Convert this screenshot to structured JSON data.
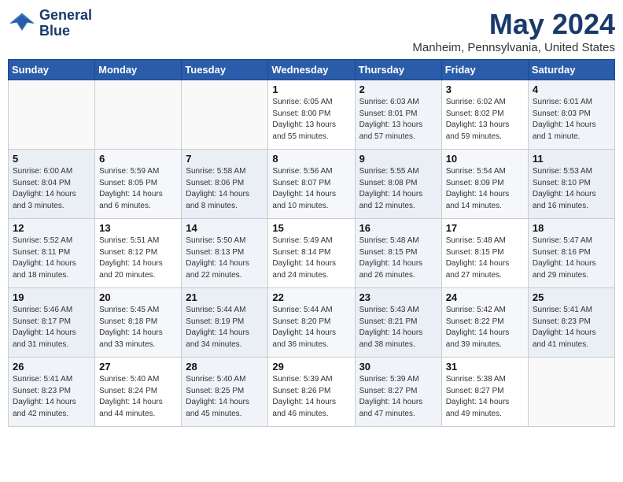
{
  "header": {
    "logo_line1": "General",
    "logo_line2": "Blue",
    "month": "May 2024",
    "location": "Manheim, Pennsylvania, United States"
  },
  "weekdays": [
    "Sunday",
    "Monday",
    "Tuesday",
    "Wednesday",
    "Thursday",
    "Friday",
    "Saturday"
  ],
  "weeks": [
    [
      {
        "day": "",
        "info": ""
      },
      {
        "day": "",
        "info": ""
      },
      {
        "day": "",
        "info": ""
      },
      {
        "day": "1",
        "info": "Sunrise: 6:05 AM\nSunset: 8:00 PM\nDaylight: 13 hours\nand 55 minutes."
      },
      {
        "day": "2",
        "info": "Sunrise: 6:03 AM\nSunset: 8:01 PM\nDaylight: 13 hours\nand 57 minutes."
      },
      {
        "day": "3",
        "info": "Sunrise: 6:02 AM\nSunset: 8:02 PM\nDaylight: 13 hours\nand 59 minutes."
      },
      {
        "day": "4",
        "info": "Sunrise: 6:01 AM\nSunset: 8:03 PM\nDaylight: 14 hours\nand 1 minute."
      }
    ],
    [
      {
        "day": "5",
        "info": "Sunrise: 6:00 AM\nSunset: 8:04 PM\nDaylight: 14 hours\nand 3 minutes."
      },
      {
        "day": "6",
        "info": "Sunrise: 5:59 AM\nSunset: 8:05 PM\nDaylight: 14 hours\nand 6 minutes."
      },
      {
        "day": "7",
        "info": "Sunrise: 5:58 AM\nSunset: 8:06 PM\nDaylight: 14 hours\nand 8 minutes."
      },
      {
        "day": "8",
        "info": "Sunrise: 5:56 AM\nSunset: 8:07 PM\nDaylight: 14 hours\nand 10 minutes."
      },
      {
        "day": "9",
        "info": "Sunrise: 5:55 AM\nSunset: 8:08 PM\nDaylight: 14 hours\nand 12 minutes."
      },
      {
        "day": "10",
        "info": "Sunrise: 5:54 AM\nSunset: 8:09 PM\nDaylight: 14 hours\nand 14 minutes."
      },
      {
        "day": "11",
        "info": "Sunrise: 5:53 AM\nSunset: 8:10 PM\nDaylight: 14 hours\nand 16 minutes."
      }
    ],
    [
      {
        "day": "12",
        "info": "Sunrise: 5:52 AM\nSunset: 8:11 PM\nDaylight: 14 hours\nand 18 minutes."
      },
      {
        "day": "13",
        "info": "Sunrise: 5:51 AM\nSunset: 8:12 PM\nDaylight: 14 hours\nand 20 minutes."
      },
      {
        "day": "14",
        "info": "Sunrise: 5:50 AM\nSunset: 8:13 PM\nDaylight: 14 hours\nand 22 minutes."
      },
      {
        "day": "15",
        "info": "Sunrise: 5:49 AM\nSunset: 8:14 PM\nDaylight: 14 hours\nand 24 minutes."
      },
      {
        "day": "16",
        "info": "Sunrise: 5:48 AM\nSunset: 8:15 PM\nDaylight: 14 hours\nand 26 minutes."
      },
      {
        "day": "17",
        "info": "Sunrise: 5:48 AM\nSunset: 8:15 PM\nDaylight: 14 hours\nand 27 minutes."
      },
      {
        "day": "18",
        "info": "Sunrise: 5:47 AM\nSunset: 8:16 PM\nDaylight: 14 hours\nand 29 minutes."
      }
    ],
    [
      {
        "day": "19",
        "info": "Sunrise: 5:46 AM\nSunset: 8:17 PM\nDaylight: 14 hours\nand 31 minutes."
      },
      {
        "day": "20",
        "info": "Sunrise: 5:45 AM\nSunset: 8:18 PM\nDaylight: 14 hours\nand 33 minutes."
      },
      {
        "day": "21",
        "info": "Sunrise: 5:44 AM\nSunset: 8:19 PM\nDaylight: 14 hours\nand 34 minutes."
      },
      {
        "day": "22",
        "info": "Sunrise: 5:44 AM\nSunset: 8:20 PM\nDaylight: 14 hours\nand 36 minutes."
      },
      {
        "day": "23",
        "info": "Sunrise: 5:43 AM\nSunset: 8:21 PM\nDaylight: 14 hours\nand 38 minutes."
      },
      {
        "day": "24",
        "info": "Sunrise: 5:42 AM\nSunset: 8:22 PM\nDaylight: 14 hours\nand 39 minutes."
      },
      {
        "day": "25",
        "info": "Sunrise: 5:41 AM\nSunset: 8:23 PM\nDaylight: 14 hours\nand 41 minutes."
      }
    ],
    [
      {
        "day": "26",
        "info": "Sunrise: 5:41 AM\nSunset: 8:23 PM\nDaylight: 14 hours\nand 42 minutes."
      },
      {
        "day": "27",
        "info": "Sunrise: 5:40 AM\nSunset: 8:24 PM\nDaylight: 14 hours\nand 44 minutes."
      },
      {
        "day": "28",
        "info": "Sunrise: 5:40 AM\nSunset: 8:25 PM\nDaylight: 14 hours\nand 45 minutes."
      },
      {
        "day": "29",
        "info": "Sunrise: 5:39 AM\nSunset: 8:26 PM\nDaylight: 14 hours\nand 46 minutes."
      },
      {
        "day": "30",
        "info": "Sunrise: 5:39 AM\nSunset: 8:27 PM\nDaylight: 14 hours\nand 47 minutes."
      },
      {
        "day": "31",
        "info": "Sunrise: 5:38 AM\nSunset: 8:27 PM\nDaylight: 14 hours\nand 49 minutes."
      },
      {
        "day": "",
        "info": ""
      }
    ]
  ]
}
